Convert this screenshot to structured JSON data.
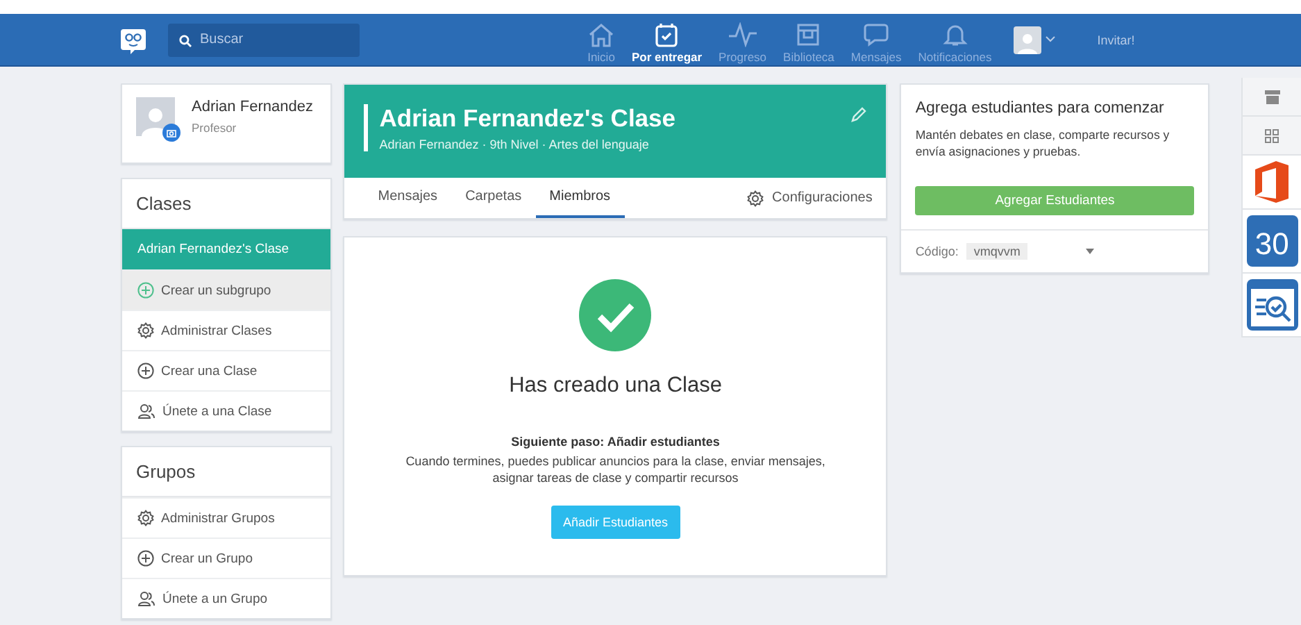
{
  "topbar": {
    "search": {
      "placeholder": "Buscar"
    },
    "nav": [
      {
        "label": "Inicio",
        "kind": "home",
        "selected": false
      },
      {
        "label": "Por entregar",
        "kind": "due",
        "selected": true
      },
      {
        "label": "Progreso",
        "kind": "progress",
        "selected": false
      },
      {
        "label": "Biblioteca",
        "kind": "library",
        "selected": false
      },
      {
        "label": "Mensajes",
        "kind": "messages",
        "selected": false
      },
      {
        "label": "Notificaciones",
        "kind": "bell",
        "selected": false
      }
    ],
    "invite": "Invitar!"
  },
  "profile": {
    "name": "Adrian Fernandez",
    "role": "Profesor"
  },
  "classes": {
    "title": "Clases",
    "items": [
      {
        "label": "Adrian Fernandez's Clase",
        "kind": "class",
        "selected": true
      },
      {
        "label": "Crear un subgrupo",
        "kind": "subgroup",
        "selected": false
      },
      {
        "label": "Administrar Clases",
        "kind": "manage",
        "selected": false
      },
      {
        "label": "Crear una Clase",
        "kind": "create",
        "selected": false
      },
      {
        "label": "Únete a una Clase",
        "kind": "join",
        "selected": false
      }
    ]
  },
  "groups": {
    "title": "Grupos",
    "items": [
      {
        "label": "Administrar Grupos",
        "kind": "manage",
        "selected": false
      },
      {
        "label": "Crear un Grupo",
        "kind": "create",
        "selected": false
      },
      {
        "label": "Únete a un Grupo",
        "kind": "join",
        "selected": false
      }
    ]
  },
  "class_header": {
    "title": "Adrian Fernandez's Clase",
    "subtitle": "Adrian Fernandez · 9th Nivel · Artes del lenguaje",
    "tabs": [
      {
        "label": "Mensajes",
        "selected": false
      },
      {
        "label": "Carpetas",
        "selected": false
      },
      {
        "label": "Miembros",
        "selected": true
      }
    ],
    "settings": "Configuraciones"
  },
  "success": {
    "heading": "Has creado una Clase",
    "next_step": "Siguiente paso: Añadir estudiantes",
    "description": "Cuando termines, puedes publicar anuncios para la clase, enviar mensajes, asignar tareas de clase y compartir recursos",
    "button": "Añadir Estudiantes"
  },
  "add_card": {
    "title": "Agrega estudiantes para comenzar",
    "text": "Mantén debates en clase, comparte recursos y envía asignaciones y pruebas.",
    "button": "Agregar Estudiantes",
    "code_label": "Código:",
    "code": "vmqvvm"
  },
  "rail": [
    {
      "kind": "store"
    },
    {
      "kind": "apps"
    },
    {
      "kind": "office"
    },
    {
      "kind": "calendar",
      "label": "30"
    },
    {
      "kind": "quiz"
    }
  ]
}
